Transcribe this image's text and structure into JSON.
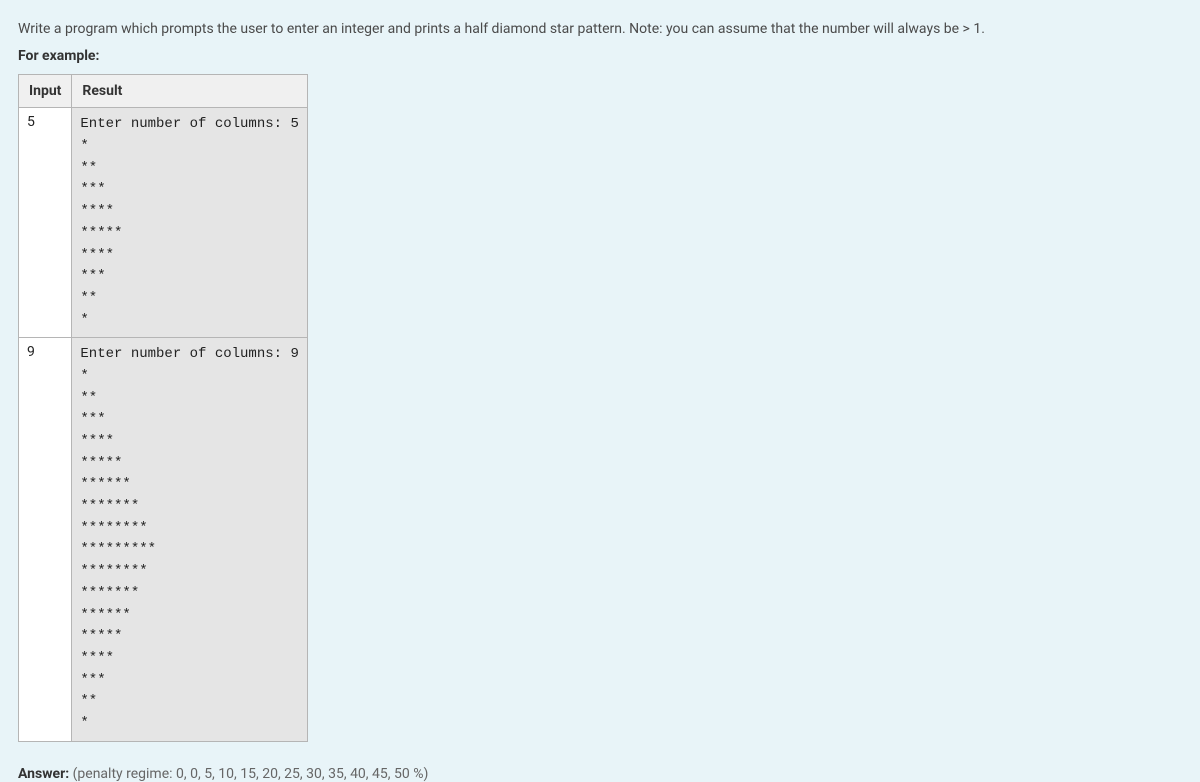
{
  "question": {
    "text": "Write a program which prompts the user to enter an integer and prints a half diamond star pattern. Note: you can assume that the number will always be > 1.",
    "example_label": "For example:"
  },
  "table": {
    "headers": [
      "Input",
      "Result"
    ],
    "rows": [
      {
        "input": "5",
        "result": "Enter number of columns: 5\n*\n**\n***\n****\n*****\n****\n***\n**\n*"
      },
      {
        "input": "9",
        "result": "Enter number of columns: 9\n*\n**\n***\n****\n*****\n******\n*******\n********\n*********\n********\n*******\n******\n*****\n****\n***\n**\n*"
      }
    ]
  },
  "answer": {
    "label": "Answer:",
    "penalty": "(penalty regime: 0, 0, 5, 10, 15, 20, 25, 30, 35, 40, 45, 50 %)"
  }
}
